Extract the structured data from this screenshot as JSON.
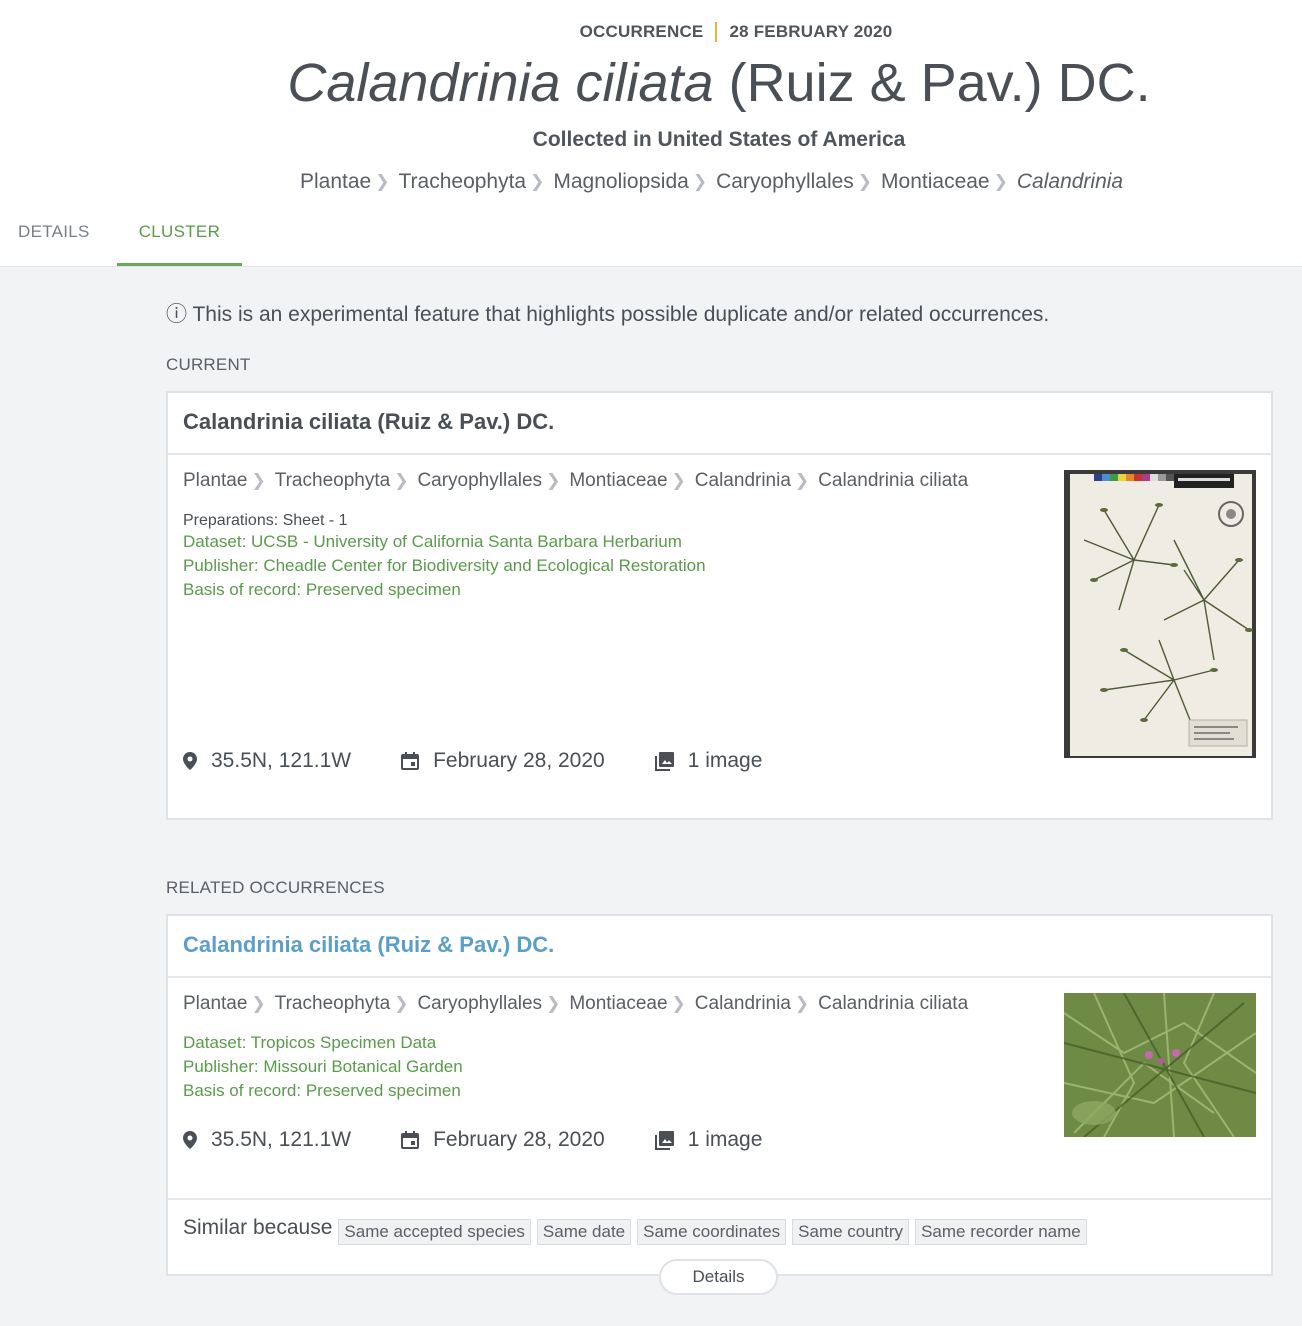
{
  "header": {
    "eyebrow_type": "OCCURRENCE",
    "eyebrow_date": "28 FEBRUARY 2020",
    "title_italic": "Calandrinia ciliata",
    "title_rest": " (Ruiz & Pav.) DC.",
    "subtitle": "Collected in United States of America",
    "breadcrumb": [
      "Plantae",
      "Tracheophyta",
      "Magnoliopsida",
      "Caryophyllales",
      "Montiaceae",
      "Calandrinia"
    ]
  },
  "tabs": [
    {
      "label": "DETAILS",
      "active": false
    },
    {
      "label": "CLUSTER",
      "active": true
    }
  ],
  "notice": "ⓘ This is an experimental feature that highlights possible duplicate and/or related occurrences.",
  "current": {
    "section_label": "CURRENT",
    "title": "Calandrinia ciliata (Ruiz & Pav.) DC.",
    "breadcrumb": [
      "Plantae",
      "Tracheophyta",
      "Caryophyllales",
      "Montiaceae",
      "Calandrinia",
      "Calandrinia ciliata"
    ],
    "preparations": "Preparations: Sheet - 1",
    "dataset": "Dataset: UCSB - University of California Santa Barbara Herbarium",
    "publisher": "Publisher: Cheadle Center for Biodiversity and Ecological Restoration",
    "basis": "Basis of record: Preserved specimen",
    "coordinates": "35.5N, 121.1W",
    "date": "February 28, 2020",
    "images": "1 image"
  },
  "related": {
    "section_label": "RELATED OCCURRENCES",
    "title": "Calandrinia ciliata (Ruiz & Pav.) DC.",
    "breadcrumb": [
      "Plantae",
      "Tracheophyta",
      "Caryophyllales",
      "Montiaceae",
      "Calandrinia",
      "Calandrinia ciliata"
    ],
    "dataset": "Dataset: Tropicos Specimen Data",
    "publisher": "Publisher: Missouri Botanical Garden",
    "basis": "Basis of record: Preserved specimen",
    "coordinates": "35.5N, 121.1W",
    "date": "February 28, 2020",
    "images": "1 image",
    "similar_label": "Similar because",
    "tags": [
      "Same accepted species",
      "Same date",
      "Same coordinates",
      "Same country",
      "Same recorder name"
    ],
    "details_button": "Details"
  },
  "icons": {
    "location": "location-pin-icon",
    "date": "calendar-icon",
    "images": "image-gallery-icon",
    "chevron": "chevron-right-icon"
  },
  "colors": {
    "accent_green": "#5a9b4b",
    "link_blue": "#5b9ec8",
    "eyebrow_separator": "#f0b33a",
    "background": "#f1f3f5"
  }
}
